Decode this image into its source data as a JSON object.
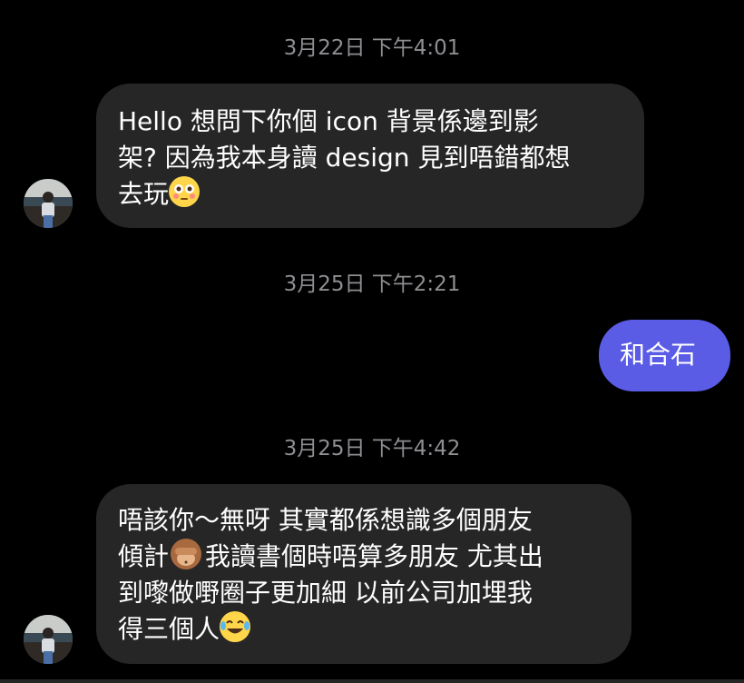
{
  "messages": [
    {
      "type": "timestamp",
      "text": "3月22日 下午4:01"
    },
    {
      "type": "incoming",
      "lines": [
        "Hello 想問下你個 icon 背景係邊到影",
        "架? 因為我本身讀 design 見到唔錯都想",
        "去玩"
      ],
      "emoji": "flushed-face-icon"
    },
    {
      "type": "timestamp",
      "text": "3月25日 下午2:21"
    },
    {
      "type": "outgoing",
      "text": "和合石"
    },
    {
      "type": "timestamp",
      "text": "3月25日 下午4:42"
    },
    {
      "type": "incoming",
      "lines": [
        "唔該你～無呀 其實都係想識多個朋友",
        "傾計",
        "我讀書個時唔算多朋友 尤其出",
        "到嚟做嘢圈子更加細 以前公司加埋我",
        "得三個人"
      ],
      "emojis": [
        "see-no-evil-monkey-icon",
        "face-with-tears-of-joy-icon"
      ]
    }
  ],
  "colors": {
    "background": "#000000",
    "incoming_bubble": "#262626",
    "outgoing_bubble": "#5b5ce6",
    "timestamp": "#8e8e93"
  }
}
